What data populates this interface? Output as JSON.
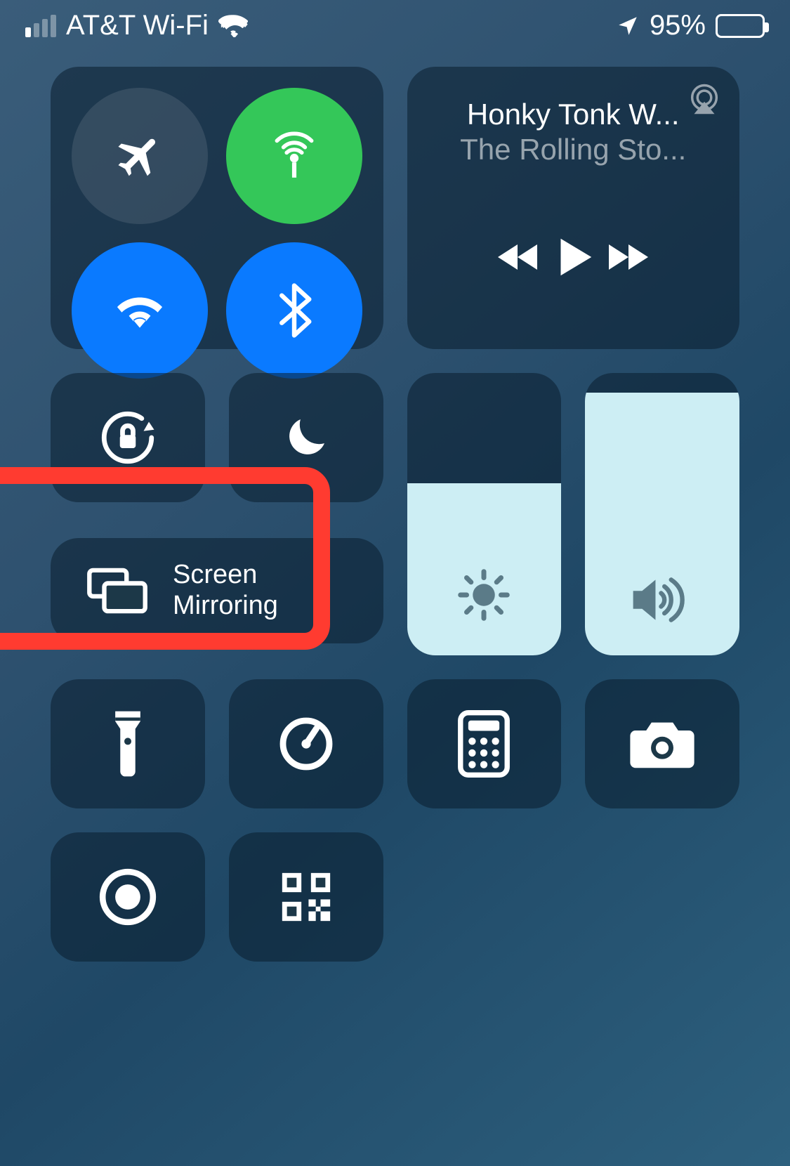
{
  "status": {
    "carrier": "AT&T Wi-Fi",
    "battery_percent": "95%"
  },
  "media": {
    "title": "Honky Tonk W...",
    "artist": "The Rolling Sto..."
  },
  "mirroring": {
    "label_line1": "Screen",
    "label_line2": "Mirroring"
  },
  "sliders": {
    "brightness_level": 0.61,
    "volume_level": 0.93
  }
}
